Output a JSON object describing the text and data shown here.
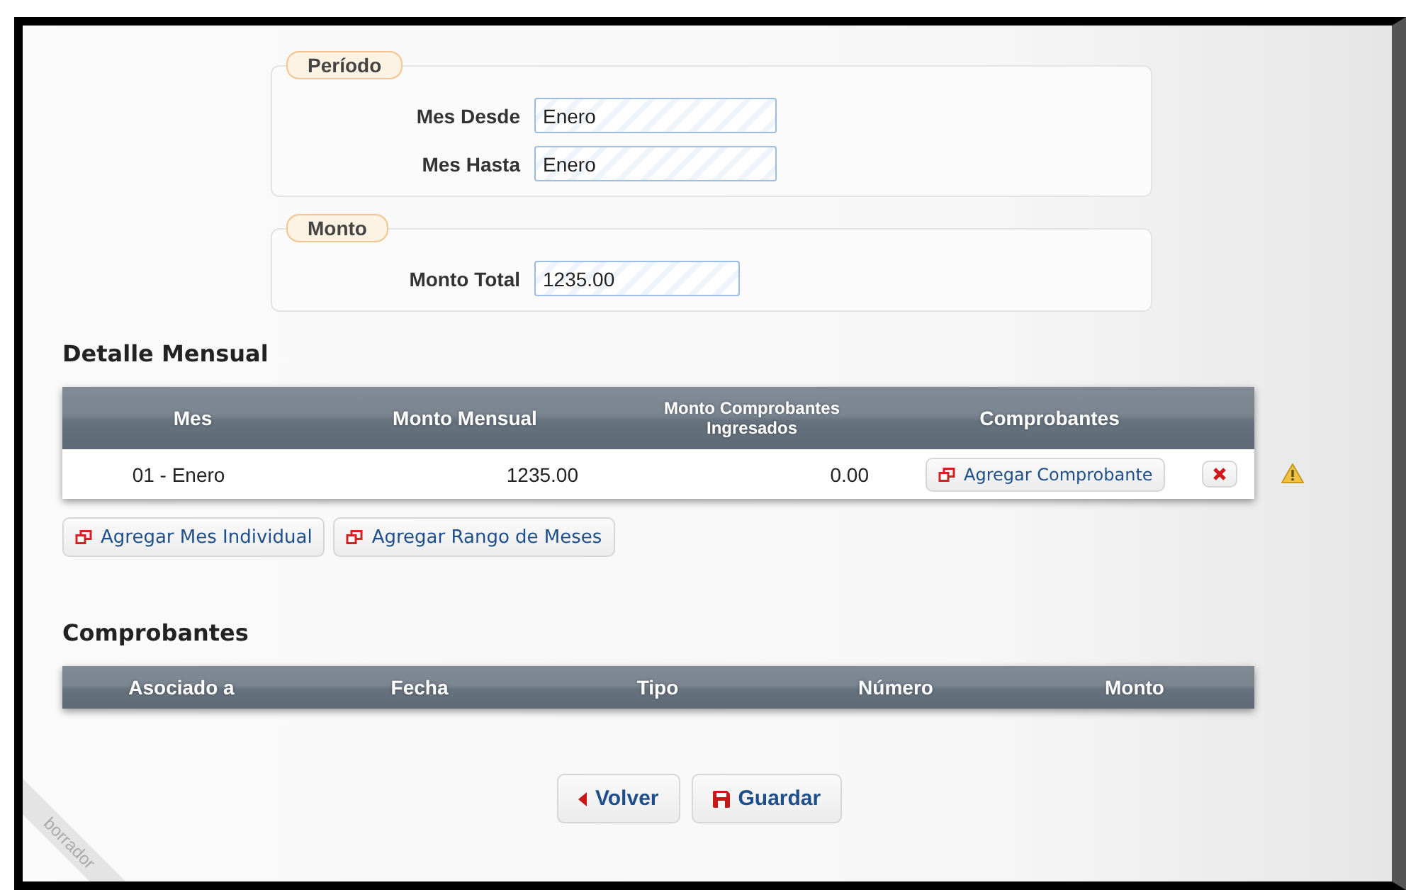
{
  "fieldsets": [
    {
      "legend": "Período",
      "fields": [
        {
          "label": "Mes Desde",
          "value": "Enero"
        },
        {
          "label": "Mes Hasta",
          "value": "Enero"
        }
      ]
    },
    {
      "legend": "Monto",
      "fields": [
        {
          "label": "Monto Total",
          "value": "1235.00"
        }
      ]
    }
  ],
  "detalle": {
    "title": "Detalle Mensual",
    "columns": [
      "Mes",
      "Monto Mensual",
      "Monto Comprobantes Ingresados",
      "Comprobantes"
    ],
    "rows": [
      {
        "mes": "01 - Enero",
        "monto_mensual": "1235.00",
        "monto_comprobantes": "0.00",
        "action": "Agregar Comprobante",
        "warning": true
      }
    ],
    "buttons": [
      "Agregar Mes Individual",
      "Agregar Rango de Meses"
    ]
  },
  "comprobantes": {
    "title": "Comprobantes",
    "columns": [
      "Asociado a",
      "Fecha",
      "Tipo",
      "Número",
      "Monto"
    ]
  },
  "footer_buttons": [
    {
      "label": "Volver",
      "kind": "back"
    },
    {
      "label": "Guardar",
      "kind": "save"
    }
  ],
  "ribbon": "borrador"
}
